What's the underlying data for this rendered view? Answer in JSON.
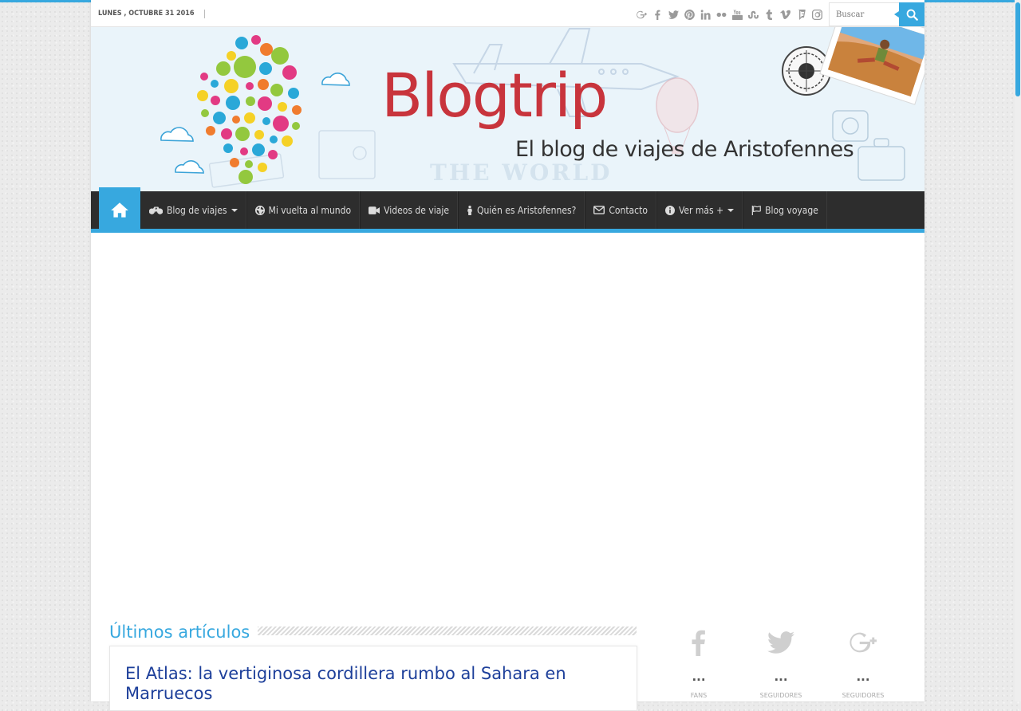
{
  "topbar": {
    "date": "LUNES , OCTUBRE 31 2016",
    "social_icons": [
      "google-plus-icon",
      "facebook-icon",
      "twitter-icon",
      "pinterest-icon",
      "linkedin-icon",
      "flickr-icon",
      "youtube-icon",
      "stumbleupon-icon",
      "tumblr-icon",
      "vimeo-icon",
      "foursquare-icon",
      "instagram-icon"
    ],
    "search_placeholder": "Buscar"
  },
  "header": {
    "logo_title": "Blogtrip",
    "tagline": "El blog de viajes de Aristofennes",
    "background_color": "#eaf4fa"
  },
  "nav": {
    "items": [
      {
        "label": "Blog de viajes",
        "icon": "bicycle-icon",
        "dropdown": true
      },
      {
        "label": "Mi vuelta al mundo",
        "icon": "globe-icon",
        "dropdown": false
      },
      {
        "label": "Videos de viaje",
        "icon": "video-camera-icon",
        "dropdown": false
      },
      {
        "label": "Quién es Aristofennes?",
        "icon": "person-icon",
        "dropdown": false
      },
      {
        "label": "Contacto",
        "icon": "envelope-icon",
        "dropdown": false
      },
      {
        "label": "Ver más +",
        "icon": "info-icon",
        "dropdown": true
      },
      {
        "label": "Blog voyage",
        "icon": "flag-icon",
        "dropdown": false
      }
    ]
  },
  "main": {
    "section_title": "Últimos artículos",
    "post_title": "El Atlas: la vertiginosa cordillera rumbo al Sahara en Marruecos"
  },
  "social_counter": [
    {
      "icon": "facebook-icon",
      "count": "...",
      "label": "FANS"
    },
    {
      "icon": "twitter-icon",
      "count": "...",
      "label": "SEGUIDORES"
    },
    {
      "icon": "google-plus-icon",
      "count": "...",
      "label": "SEGUIDORES"
    }
  ],
  "colors": {
    "accent": "#37a8df",
    "nav_bg": "#2d2d2d",
    "logo_red": "#c8343c",
    "post_title": "#1d3f9a"
  }
}
